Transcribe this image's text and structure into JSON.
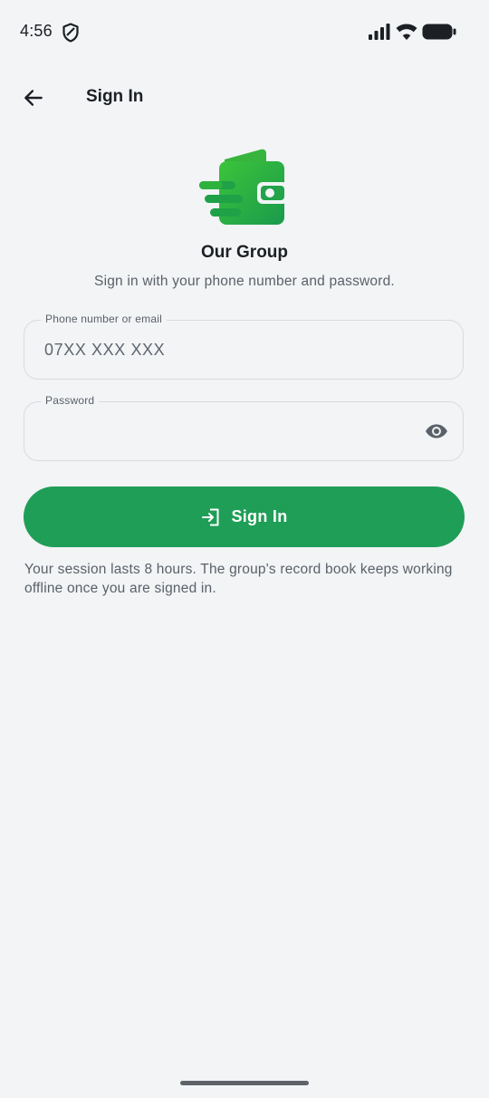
{
  "status_bar": {
    "time": "4:56",
    "icons": [
      "shield-icon",
      "signal-icon",
      "wifi-icon",
      "battery-icon"
    ]
  },
  "app_bar": {
    "back_icon": "arrow-left-icon",
    "title": "Sign In"
  },
  "brand": {
    "logo_icon": "wallet-icon",
    "name": "Our Group",
    "subtitle": "Sign in with your phone number and password.",
    "accent_color": "#1f9e57"
  },
  "form": {
    "phone": {
      "label": "Phone number or email",
      "value": "",
      "placeholder": "07XX XXX XXX"
    },
    "password": {
      "label": "Password",
      "value": "",
      "placeholder": "",
      "toggle_icon": "eye-icon"
    },
    "submit": {
      "label": "Sign In",
      "icon": "login-icon"
    }
  },
  "note": "Your session lasts 8 hours. The group's record book keeps working offline once you are signed in."
}
